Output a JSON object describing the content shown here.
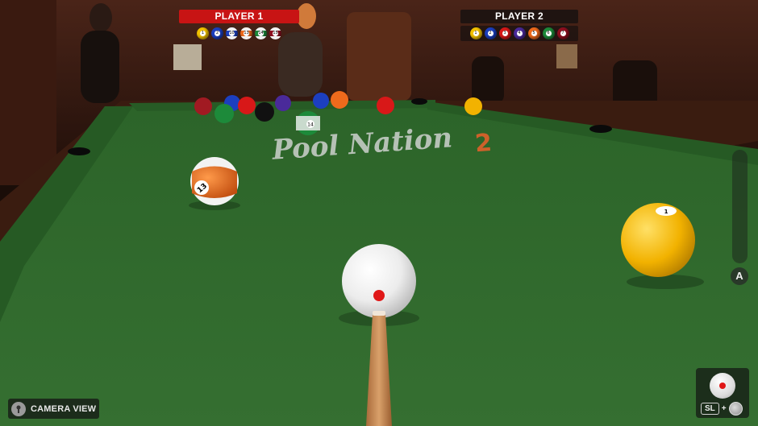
{
  "hud": {
    "player1": {
      "name": "PLAYER 1",
      "balls": [
        {
          "number": "1",
          "color": "#f2c200",
          "stripe": false
        },
        {
          "number": "2",
          "color": "#1c3fbf",
          "stripe": false
        },
        {
          "number": "10",
          "color": "#1c3fbf",
          "stripe": true
        },
        {
          "number": "13",
          "color": "#ee6a1c",
          "stripe": true
        },
        {
          "number": "14",
          "color": "#1d8a3a",
          "stripe": true
        },
        {
          "number": "15",
          "color": "#8e1020",
          "stripe": true
        }
      ]
    },
    "player2": {
      "name": "PLAYER 2",
      "balls": [
        {
          "number": "1",
          "color": "#f2c200",
          "stripe": false
        },
        {
          "number": "2",
          "color": "#1c3fbf",
          "stripe": false
        },
        {
          "number": "3",
          "color": "#d81818",
          "stripe": false
        },
        {
          "number": "4",
          "color": "#4a2a9a",
          "stripe": false
        },
        {
          "number": "5",
          "color": "#ee6a1c",
          "stripe": false
        },
        {
          "number": "6",
          "color": "#1d8a3a",
          "stripe": false
        },
        {
          "number": "7",
          "color": "#8e1020",
          "stripe": false
        }
      ]
    }
  },
  "table_logo": {
    "text": "Pool Nation",
    "number": "2"
  },
  "balls_on_table": {
    "near_left_label": "13",
    "near_right_label": "1",
    "mid_label": "14"
  },
  "controls": {
    "camera_view_label": "CAMERA VIEW",
    "a_button_label": "A",
    "spin_key_label": "SL",
    "spin_key_plus": "+"
  },
  "colors": {
    "felt": "#2f6a2c",
    "player1_accent": "#c81414",
    "cue_tip_dot": "#e01818"
  }
}
